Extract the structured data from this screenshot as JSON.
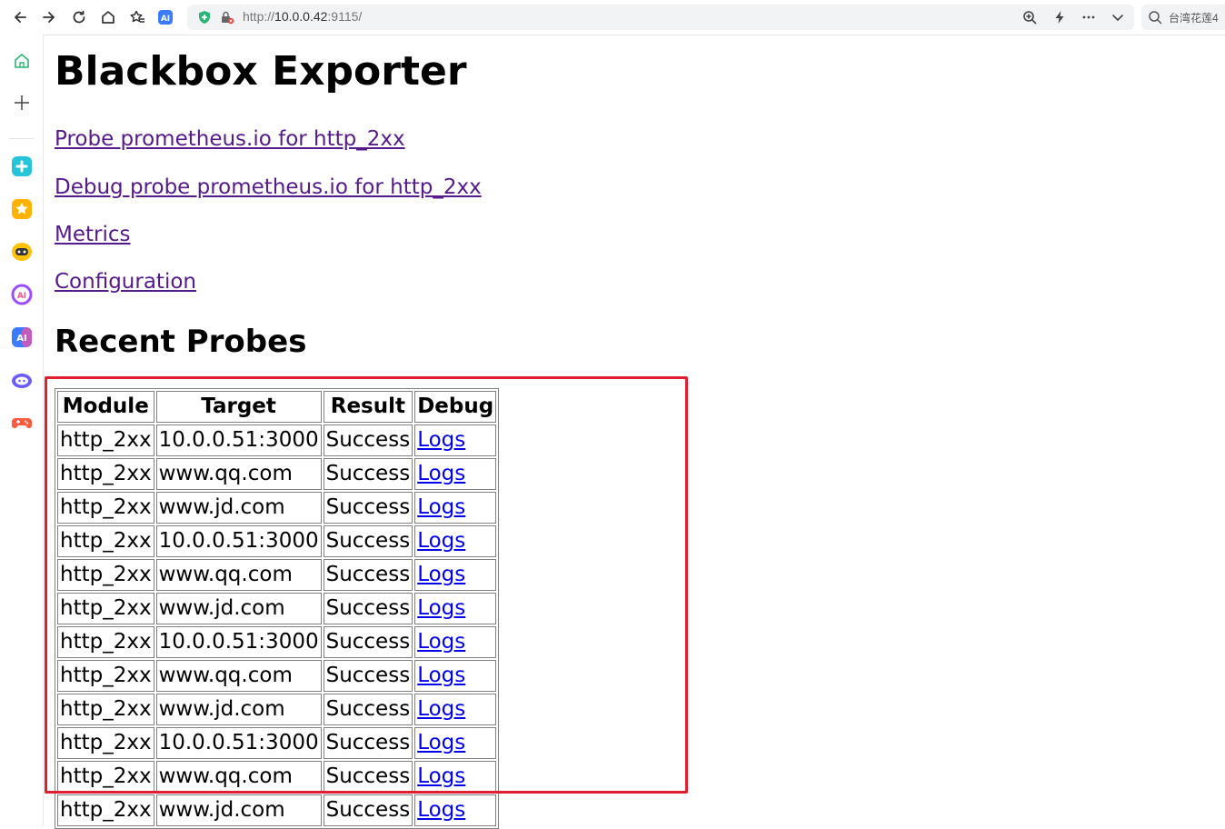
{
  "browser": {
    "url_protocol": "http://",
    "url_host": "10.0.0.42",
    "url_port": ":9115/",
    "search_text": "台湾花莲4",
    "toolbar_icons": [
      "back-icon",
      "forward-icon",
      "reload-icon",
      "home-icon",
      "favorites-icon",
      "ai-assistant-icon"
    ],
    "address_icons": [
      "shield-icon",
      "insecure-lock-icon",
      "zoom-icon",
      "lightning-icon",
      "more-icon",
      "chevron-down-icon"
    ]
  },
  "sidebar": {
    "items": [
      {
        "icon": "home-icon"
      },
      {
        "icon": "add-icon"
      },
      {
        "icon": "app-teal-icon"
      },
      {
        "icon": "star-app-icon"
      },
      {
        "icon": "chat-bot-icon"
      },
      {
        "icon": "ai-circle-icon"
      },
      {
        "icon": "ai-square-icon"
      },
      {
        "icon": "robot-icon"
      },
      {
        "icon": "gamepad-icon"
      }
    ]
  },
  "page": {
    "title": "Blackbox Exporter",
    "links": [
      {
        "label": "Probe prometheus.io for http_2xx"
      },
      {
        "label": "Debug probe prometheus.io for http_2xx"
      },
      {
        "label": "Metrics"
      },
      {
        "label": "Configuration"
      }
    ],
    "section_title": "Recent Probes",
    "table": {
      "headers": [
        "Module",
        "Target",
        "Result",
        "Debug"
      ],
      "rows": [
        [
          "http_2xx",
          "10.0.0.51:3000",
          "Success",
          "Logs"
        ],
        [
          "http_2xx",
          "www.qq.com",
          "Success",
          "Logs"
        ],
        [
          "http_2xx",
          "www.jd.com",
          "Success",
          "Logs"
        ],
        [
          "http_2xx",
          "10.0.0.51:3000",
          "Success",
          "Logs"
        ],
        [
          "http_2xx",
          "www.qq.com",
          "Success",
          "Logs"
        ],
        [
          "http_2xx",
          "www.jd.com",
          "Success",
          "Logs"
        ],
        [
          "http_2xx",
          "10.0.0.51:3000",
          "Success",
          "Logs"
        ],
        [
          "http_2xx",
          "www.qq.com",
          "Success",
          "Logs"
        ],
        [
          "http_2xx",
          "www.jd.com",
          "Success",
          "Logs"
        ],
        [
          "http_2xx",
          "10.0.0.51:3000",
          "Success",
          "Logs"
        ],
        [
          "http_2xx",
          "www.qq.com",
          "Success",
          "Logs"
        ],
        [
          "http_2xx",
          "www.jd.com",
          "Success",
          "Logs"
        ]
      ]
    }
  },
  "colors": {
    "visited_link": "#551a8b",
    "link": "#0000ee",
    "highlight": "#e02030"
  }
}
